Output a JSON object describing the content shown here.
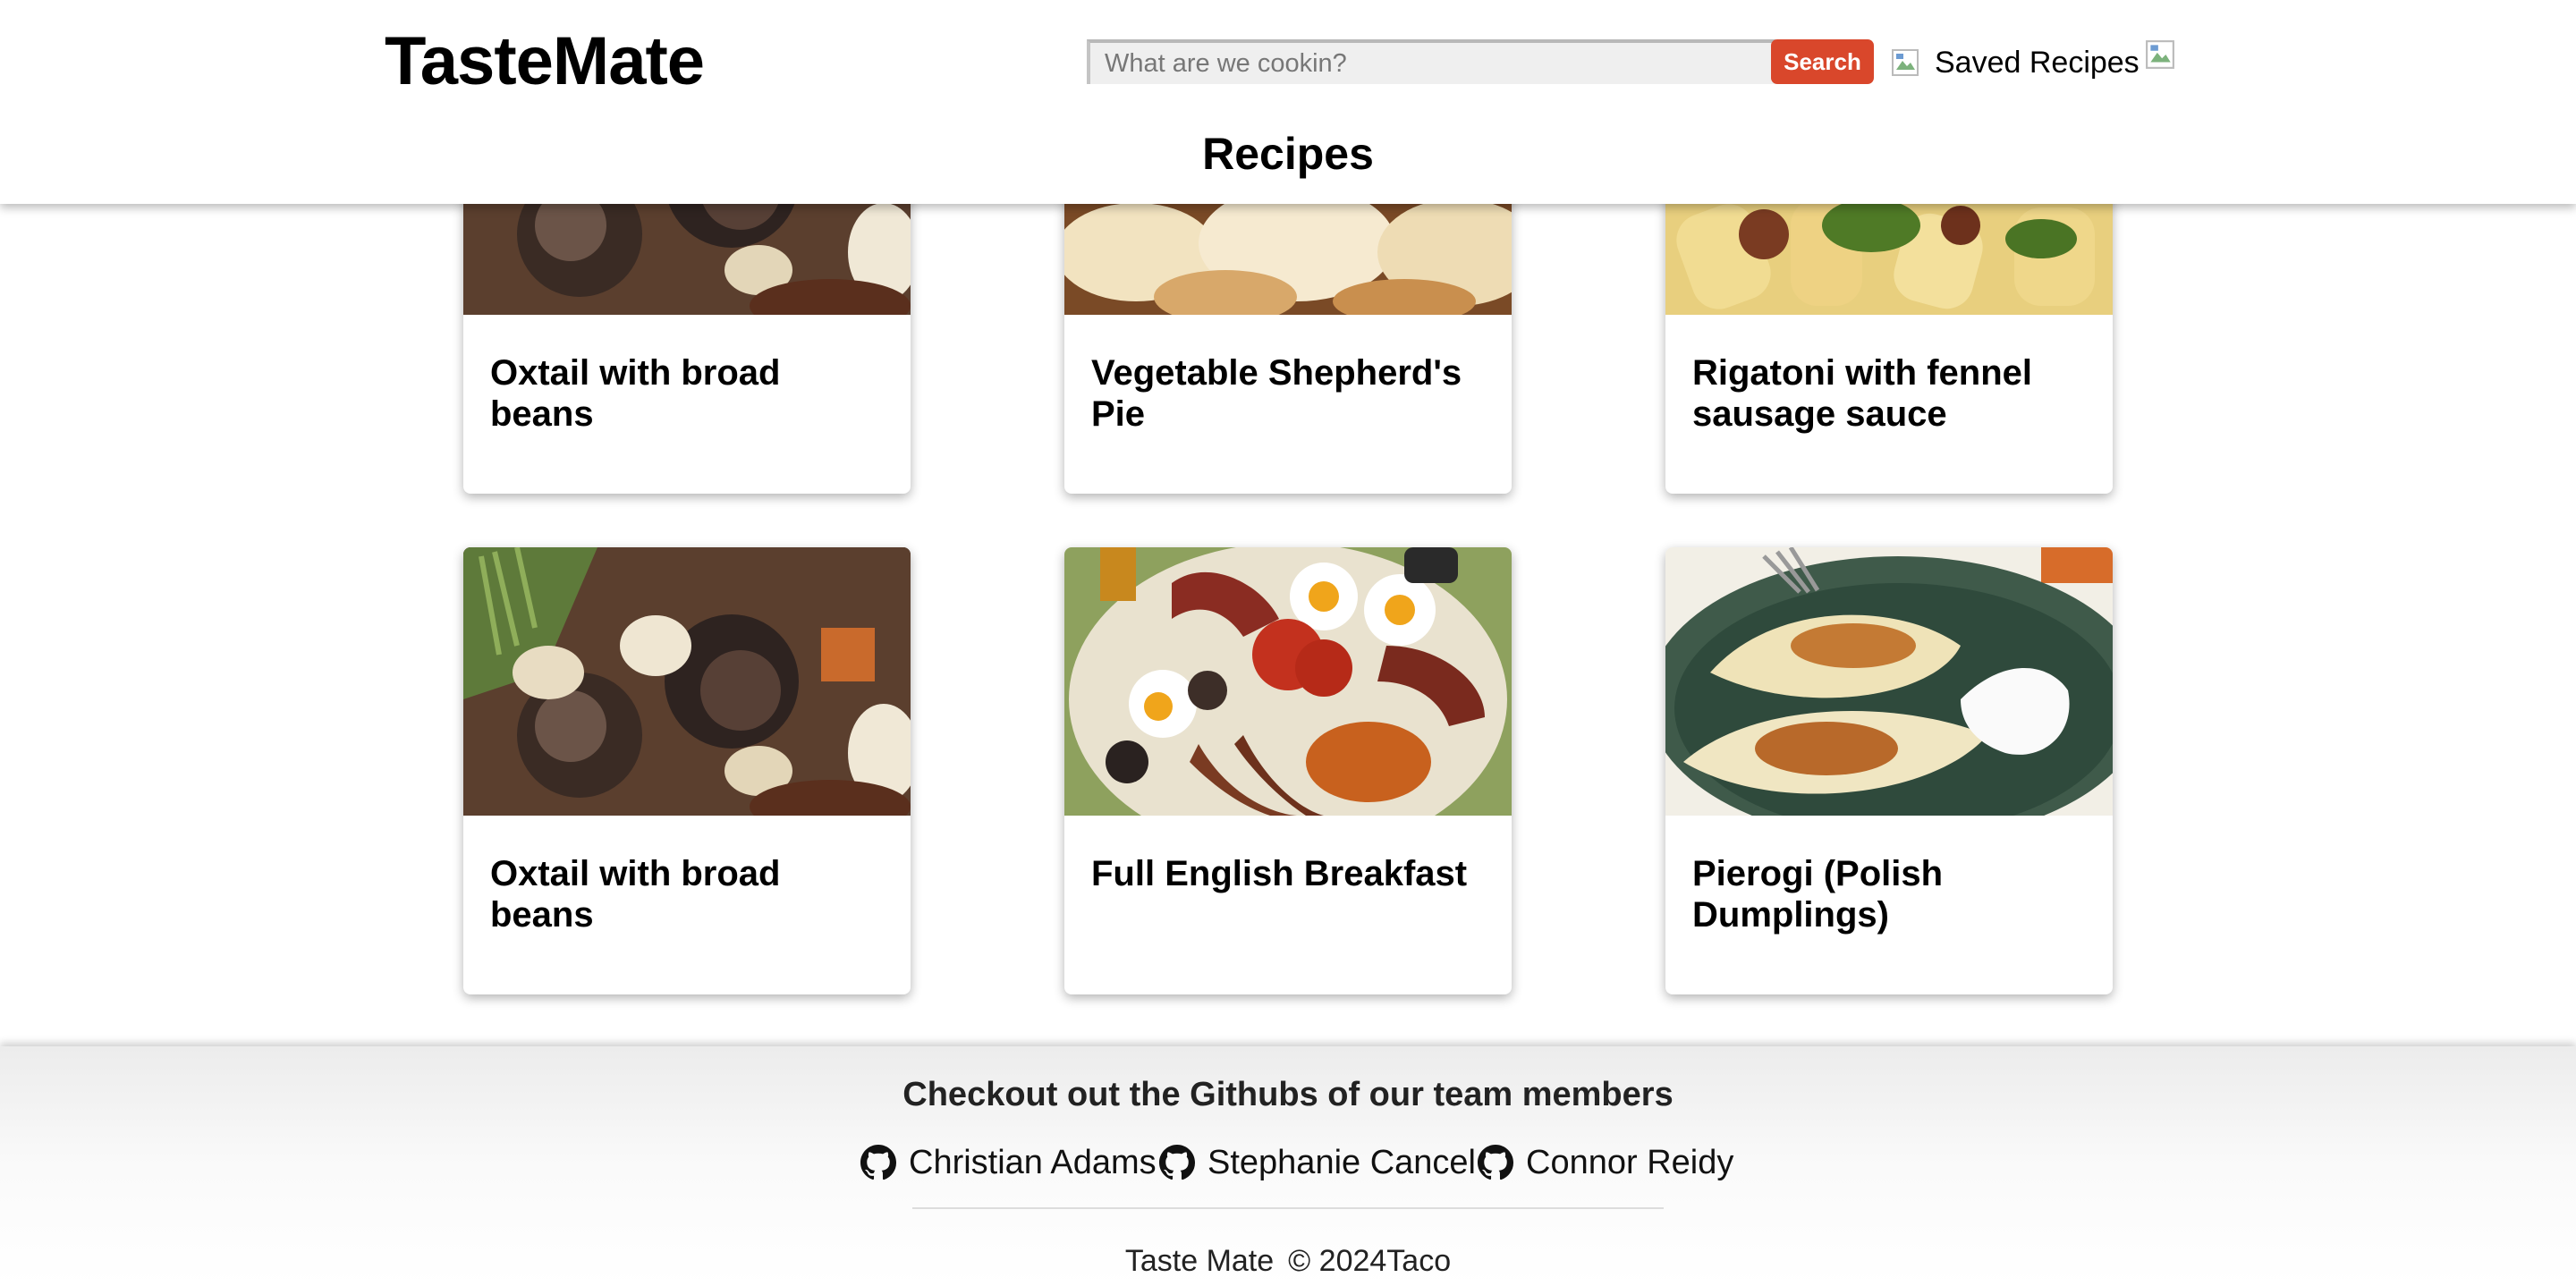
{
  "header": {
    "brand": "TasteMate",
    "search": {
      "placeholder": "What are we cookin?",
      "button_label": "Search"
    },
    "saved_link": "Saved Recipes",
    "page_title": "Recipes"
  },
  "recipes": [
    {
      "title": "Oxtail with broad beans",
      "image": "oxtail-stew-photo"
    },
    {
      "title": "Vegetable Shepherd's Pie",
      "image": "shepherds-pie-photo"
    },
    {
      "title": "Rigatoni with fennel sausage sauce",
      "image": "rigatoni-photo"
    },
    {
      "title": "Oxtail with broad beans",
      "image": "oxtail-stew-photo"
    },
    {
      "title": "Full English Breakfast",
      "image": "english-breakfast-photo"
    },
    {
      "title": "Pierogi (Polish Dumplings)",
      "image": "pierogi-photo"
    }
  ],
  "footer": {
    "heading": "Checkout out the Githubs of our team members",
    "members": [
      "Christian Adams",
      "Stephanie Cancel",
      "Connor Reidy"
    ],
    "brand": "Taste Mate",
    "copyright": "© 2024Taco"
  },
  "colors": {
    "accent": "#d9472b",
    "text": "#000000",
    "footer_bg": "#ececec"
  },
  "icons": [
    "github-icon",
    "broken-image-icon"
  ]
}
